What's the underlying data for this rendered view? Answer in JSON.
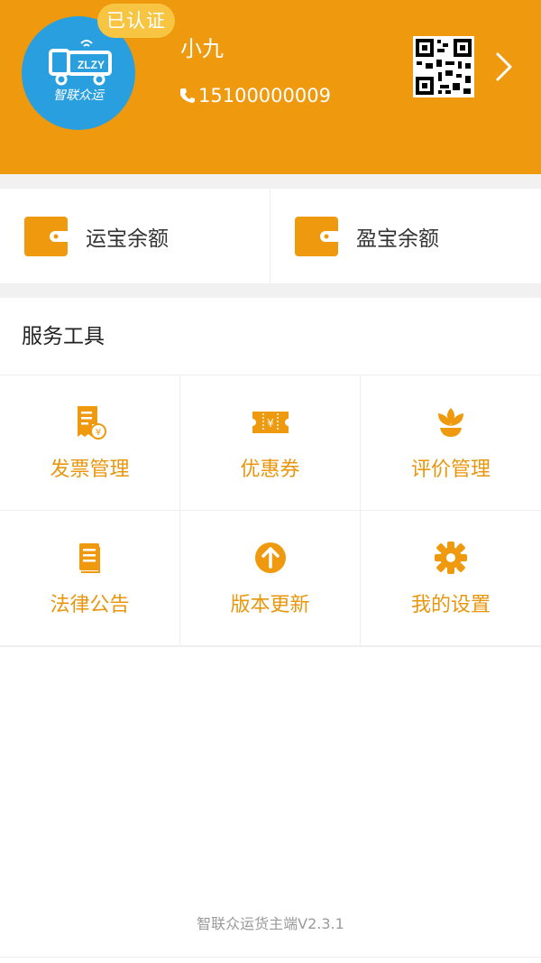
{
  "profile": {
    "badge": "已认证",
    "name": "小九",
    "phone": "15100000009",
    "avatar_logo_text": "智联众运",
    "icons": {
      "phone": "phone-icon",
      "qr": "qr-code-icon",
      "chevron": "chevron-right-icon"
    }
  },
  "balances": [
    {
      "label": "运宝余额",
      "icon": "wallet-icon"
    },
    {
      "label": "盈宝余额",
      "icon": "wallet-icon"
    }
  ],
  "tools": {
    "title": "服务工具",
    "items": [
      {
        "label": "发票管理",
        "icon": "invoice-icon"
      },
      {
        "label": "优惠券",
        "icon": "coupon-icon"
      },
      {
        "label": "评价管理",
        "icon": "flower-icon"
      },
      {
        "label": "法律公告",
        "icon": "document-icon"
      },
      {
        "label": "版本更新",
        "icon": "upload-arrow-icon"
      },
      {
        "label": "我的设置",
        "icon": "gear-icon"
      }
    ]
  },
  "footer": {
    "version_text": "智联众运货主端V2.3.1"
  },
  "colors": {
    "accent": "#ef9a0e",
    "badge": "#f7c542",
    "avatar_bg": "#2a9fe0",
    "tool_label": "#e8960d"
  }
}
